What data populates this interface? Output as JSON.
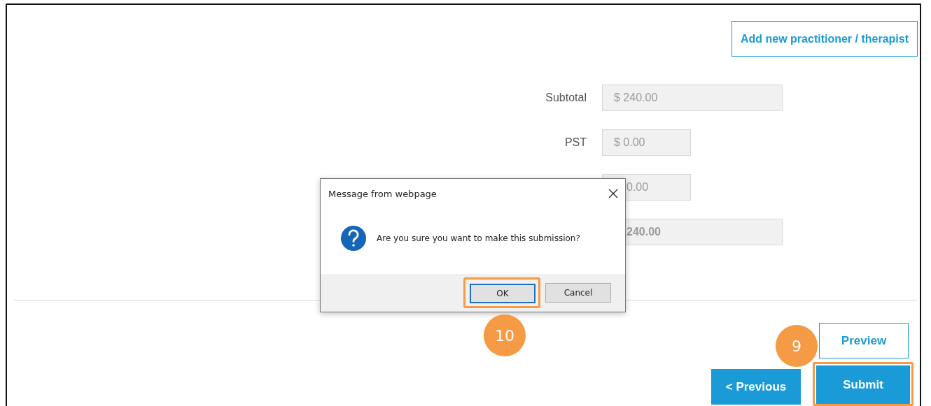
{
  "page": {
    "add_button": "Add new practitioner / therapist",
    "summary": [
      {
        "label": "Subtotal",
        "value": "$ 240.00",
        "kind": "wide",
        "bold": false,
        "covered": false
      },
      {
        "label": "PST",
        "value": "$ 0.00",
        "kind": "narrow",
        "bold": false,
        "covered": false
      },
      {
        "value": "0.00",
        "kind": "narrow",
        "bold": false,
        "covered": true
      },
      {
        "value": "240.00",
        "kind": "wide",
        "bold": true,
        "covered": true
      }
    ],
    "buttons": [
      {
        "kind": "preview",
        "label": "Preview"
      },
      {
        "kind": "previous",
        "label": "< Previous"
      },
      {
        "kind": "submit",
        "label": "Submit",
        "step": "9"
      }
    ]
  },
  "dialog": {
    "title": "Message from webpage",
    "message": "Are you sure you want to make this submission?",
    "buttons": [
      {
        "label": "OK",
        "focused": true,
        "step": "10"
      },
      {
        "label": "Cancel",
        "focused": false
      }
    ]
  }
}
